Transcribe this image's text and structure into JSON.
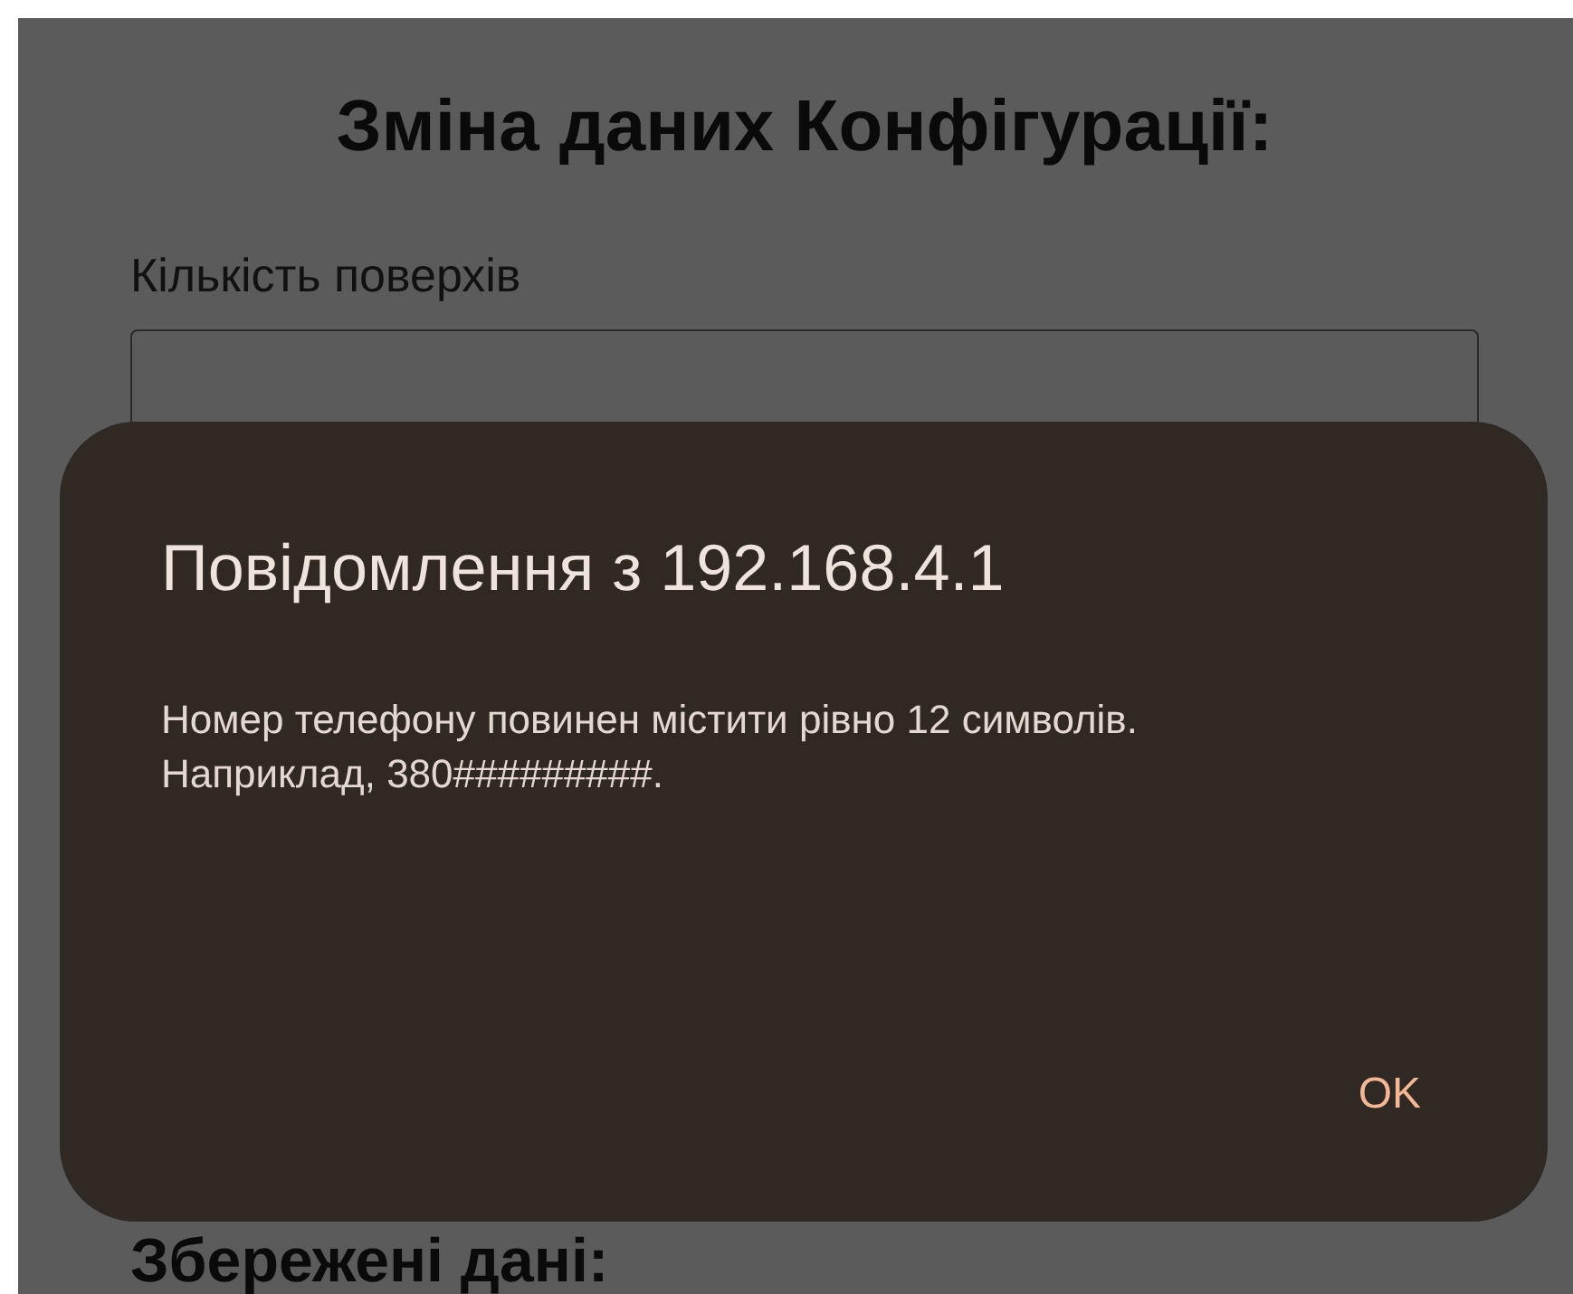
{
  "page": {
    "title": "Зміна даних Конфігурації:",
    "field_label": "Кількість поверхів",
    "section_heading": "Збережені дані:"
  },
  "dialog": {
    "title": "Повідомлення з 192.168.4.1",
    "message": "Номер телефону повинен містити рівно 12 символів. Наприклад, 380#########.",
    "buttons": [
      "OK"
    ]
  }
}
